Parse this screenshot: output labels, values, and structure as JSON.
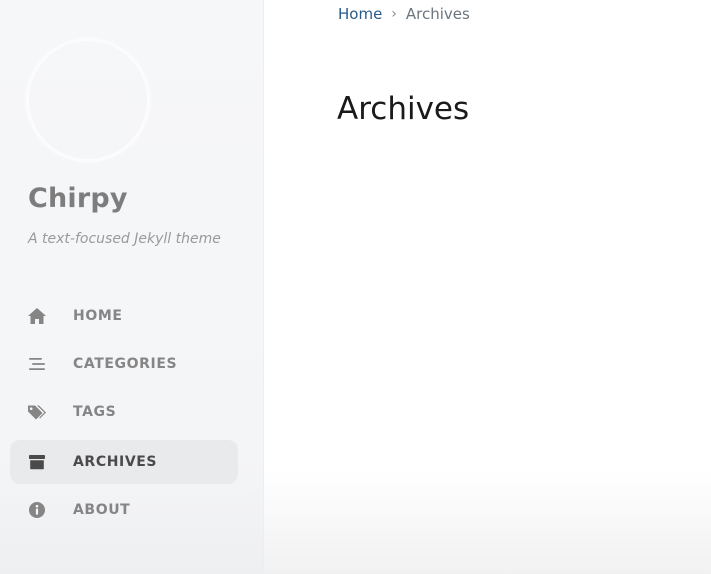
{
  "sidebar": {
    "site_title": "Chirpy",
    "site_subtitle": "A text-focused Jekyll theme",
    "nav": [
      {
        "label": "HOME",
        "icon": "home-icon",
        "active": false
      },
      {
        "label": "CATEGORIES",
        "icon": "stream-icon",
        "active": false
      },
      {
        "label": "TAGS",
        "icon": "tags-icon",
        "active": false
      },
      {
        "label": "ARCHIVES",
        "icon": "archive-icon",
        "active": true
      },
      {
        "label": "ABOUT",
        "icon": "info-circle-icon",
        "active": false
      }
    ]
  },
  "breadcrumb": {
    "home": "Home",
    "separator": "›",
    "current": "Archives"
  },
  "main": {
    "title": "Archives"
  },
  "colors": {
    "link": "#2a5a8c",
    "nav_text": "#858585",
    "active_bg": "#e9eaec"
  }
}
